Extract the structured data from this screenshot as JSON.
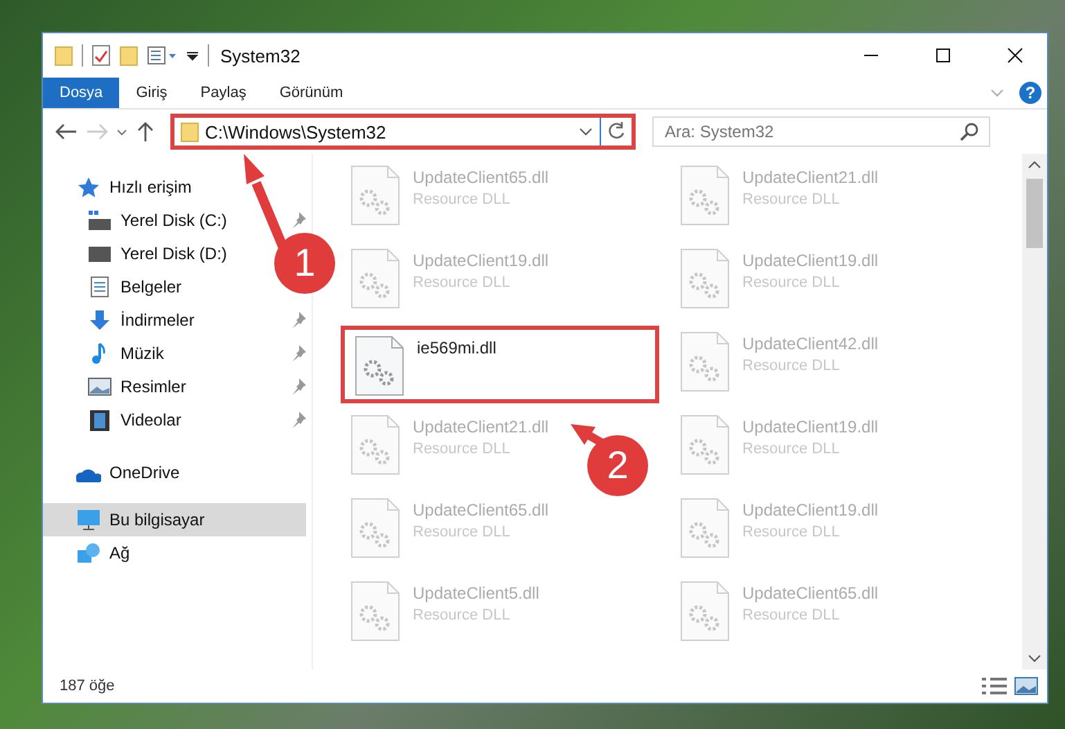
{
  "window": {
    "title": "System32"
  },
  "ribbon_tabs": [
    {
      "label": "Dosya",
      "selected": true
    },
    {
      "label": "Giriş",
      "selected": false
    },
    {
      "label": "Paylaş",
      "selected": false
    },
    {
      "label": "Görünüm",
      "selected": false
    }
  ],
  "help_button": {
    "label": "?"
  },
  "address": {
    "path": "C:\\Windows\\System32",
    "highlighted": true
  },
  "search": {
    "placeholder": "Ara: System32"
  },
  "sidebar": {
    "items": [
      {
        "label": "Hızlı erişim",
        "kind": "star",
        "selected": false,
        "children": [
          {
            "label": "Yerel Disk (C:)",
            "kind": "drive-win",
            "pinned": true,
            "selected": false
          },
          {
            "label": "Yerel Disk (D:)",
            "kind": "drive",
            "pinned": false,
            "selected": false
          },
          {
            "label": "Belgeler",
            "kind": "doc",
            "pinned": false,
            "selected": false
          },
          {
            "label": "İndirmeler",
            "kind": "download",
            "pinned": true,
            "selected": false
          },
          {
            "label": "Müzik",
            "kind": "music",
            "pinned": true,
            "selected": false
          },
          {
            "label": "Resimler",
            "kind": "picture",
            "pinned": true,
            "selected": false
          },
          {
            "label": "Videolar",
            "kind": "video",
            "pinned": true,
            "selected": false
          }
        ]
      },
      {
        "label": "OneDrive",
        "kind": "cloud",
        "selected": false
      },
      {
        "label": "Bu bilgisayar",
        "kind": "pc",
        "selected": true
      },
      {
        "label": "Ağ",
        "kind": "network",
        "selected": false
      }
    ]
  },
  "files": [
    {
      "name": "UpdateClient65.dll",
      "type": "Resource DLL",
      "blurred": true,
      "highlighted": false
    },
    {
      "name": "UpdateClient21.dll",
      "type": "Resource DLL",
      "blurred": true,
      "highlighted": false
    },
    {
      "name": "UpdateClient19.dll",
      "type": "Resource DLL",
      "blurred": true,
      "highlighted": false
    },
    {
      "name": "UpdateClient19.dll",
      "type": "Resource DLL",
      "blurred": true,
      "highlighted": false
    },
    {
      "name": "ie569mi.dll",
      "blurred": false,
      "highlighted": true
    },
    {
      "name": "UpdateClient42.dll",
      "type": "Resource DLL",
      "blurred": true,
      "highlighted": false
    },
    {
      "name": "UpdateClient21.dll",
      "type": "Resource DLL",
      "blurred": true,
      "highlighted": false
    },
    {
      "name": "UpdateClient19.dll",
      "type": "Resource DLL",
      "blurred": true,
      "highlighted": false
    },
    {
      "name": "UpdateClient65.dll",
      "type": "Resource DLL",
      "blurred": true,
      "highlighted": false
    },
    {
      "name": "UpdateClient19.dll",
      "type": "Resource DLL",
      "blurred": true,
      "highlighted": false
    },
    {
      "name": "UpdateClient5.dll",
      "type": "Resource DLL",
      "blurred": true,
      "highlighted": false
    },
    {
      "name": "UpdateClient65.dll",
      "type": "Resource DLL",
      "blurred": true,
      "highlighted": false
    }
  ],
  "status_bar": {
    "count": "187 öğe"
  },
  "annotations": [
    {
      "number": "1"
    },
    {
      "number": "2"
    }
  ]
}
